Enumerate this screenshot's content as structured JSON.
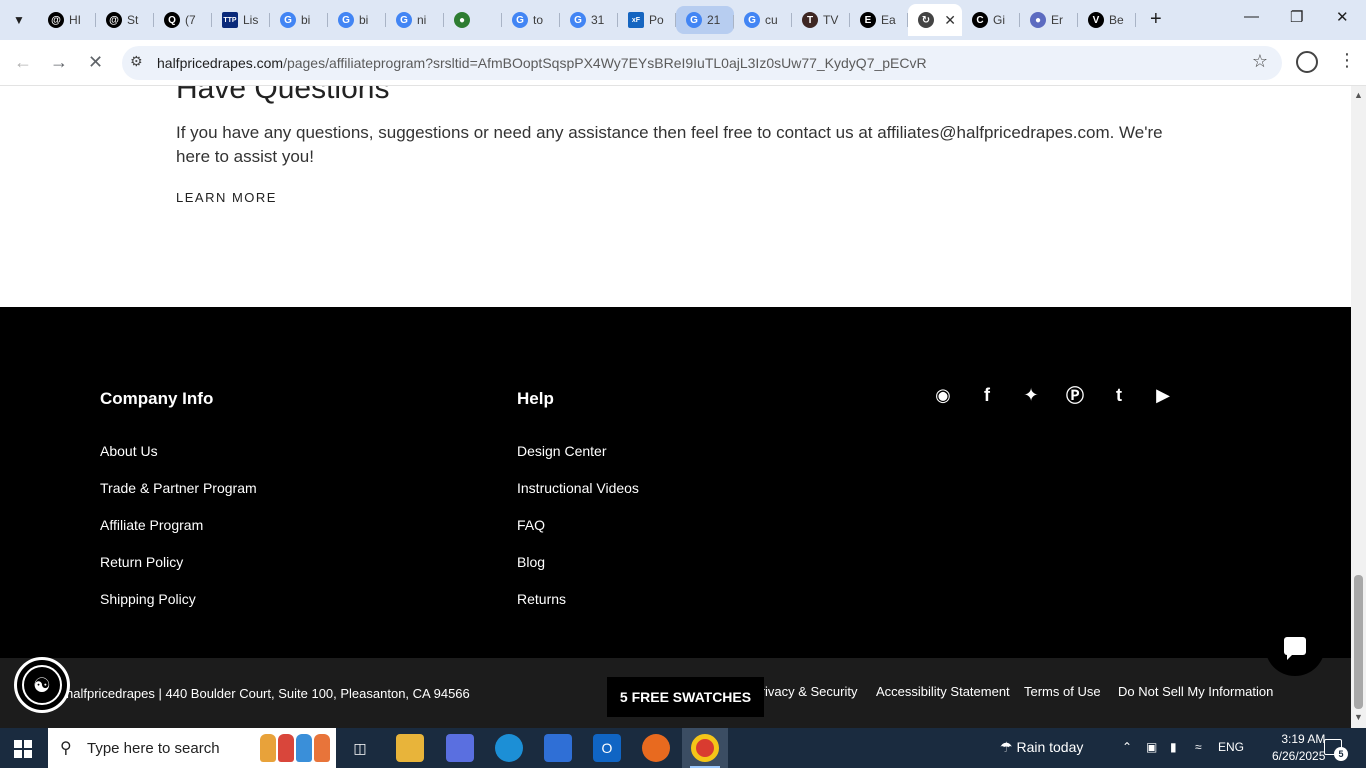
{
  "browser": {
    "tabs": [
      {
        "label": "HI",
        "icon": "threads-icon",
        "color": "#000000"
      },
      {
        "label": "St",
        "icon": "threads-icon",
        "color": "#000000"
      },
      {
        "label": "(7",
        "icon": "quora-icon",
        "color": "#000000"
      },
      {
        "label": "Lis",
        "icon": "ttp-icon",
        "color": "#0a2a7a"
      },
      {
        "label": "bi",
        "icon": "google-icon",
        "color": "#4285f4"
      },
      {
        "label": "bi",
        "icon": "google-icon",
        "color": "#4285f4"
      },
      {
        "label": "ni",
        "icon": "google-icon",
        "color": "#4285f4"
      },
      {
        "label": "",
        "icon": "extension-icon",
        "color": "#2e7d32"
      },
      {
        "label": "to",
        "icon": "google-icon",
        "color": "#4285f4"
      },
      {
        "label": "31",
        "icon": "google-icon",
        "color": "#4285f4"
      },
      {
        "label": "Po",
        "icon": "xf-icon",
        "color": "#1565c0"
      },
      {
        "label": "21",
        "icon": "google-icon",
        "color": "#4285f4"
      },
      {
        "label": "cu",
        "icon": "google-icon",
        "color": "#4285f4"
      },
      {
        "label": "TV",
        "icon": "t-icon",
        "color": "#3e2723"
      },
      {
        "label": "Ea",
        "icon": "e-icon",
        "color": "#000000"
      },
      {
        "label": "",
        "icon": "loading-icon",
        "color": "#444444"
      },
      {
        "label": "Gi",
        "icon": "c-icon",
        "color": "#000000"
      },
      {
        "label": "Er",
        "icon": "globe-icon",
        "color": "#5c6bc0"
      },
      {
        "label": "Be",
        "icon": "v-icon",
        "color": "#000000"
      }
    ],
    "url_host": "halfpricedrapes.com",
    "url_path": "/pages/affiliateprogram?srsltid=AfmBOoptSqspPX4Wy7EYsBReI9IuTL0ajL3Iz0sUw77_KydyQ7_pECvR"
  },
  "page": {
    "heading": "Have Questions",
    "body": "If you have any questions, suggestions or need any assistance then feel free to contact us at affiliates@halfpricedrapes.com. We're here to assist you!",
    "learn_more": "LEARN MORE"
  },
  "footer": {
    "company_title": "Company Info",
    "company_links": [
      "About Us",
      "Trade & Partner Program",
      "Affiliate Program",
      "Return Policy",
      "Shipping Policy"
    ],
    "help_title": "Help",
    "help_links": [
      "Design Center",
      "Instructional Videos",
      "FAQ",
      "Blog",
      "Returns"
    ],
    "social": [
      "instagram-icon",
      "facebook-icon",
      "twitter-icon",
      "pinterest-icon",
      "tumblr-icon",
      "youtube-icon"
    ],
    "address": "halfpricedrapes | 440 Boulder Court, Suite 100, Pleasanton, CA 94566",
    "legal": [
      "Privacy & Security",
      "Accessibility Statement",
      "Terms of Use",
      "Do Not Sell My Information"
    ],
    "swatches_button": "5 FREE SWATCHES"
  },
  "taskbar": {
    "search_placeholder": "Type here to search",
    "weather": "Rain today",
    "lang": "ENG",
    "time": "3:19 AM",
    "date": "6/26/2025",
    "notification_count": "5"
  }
}
